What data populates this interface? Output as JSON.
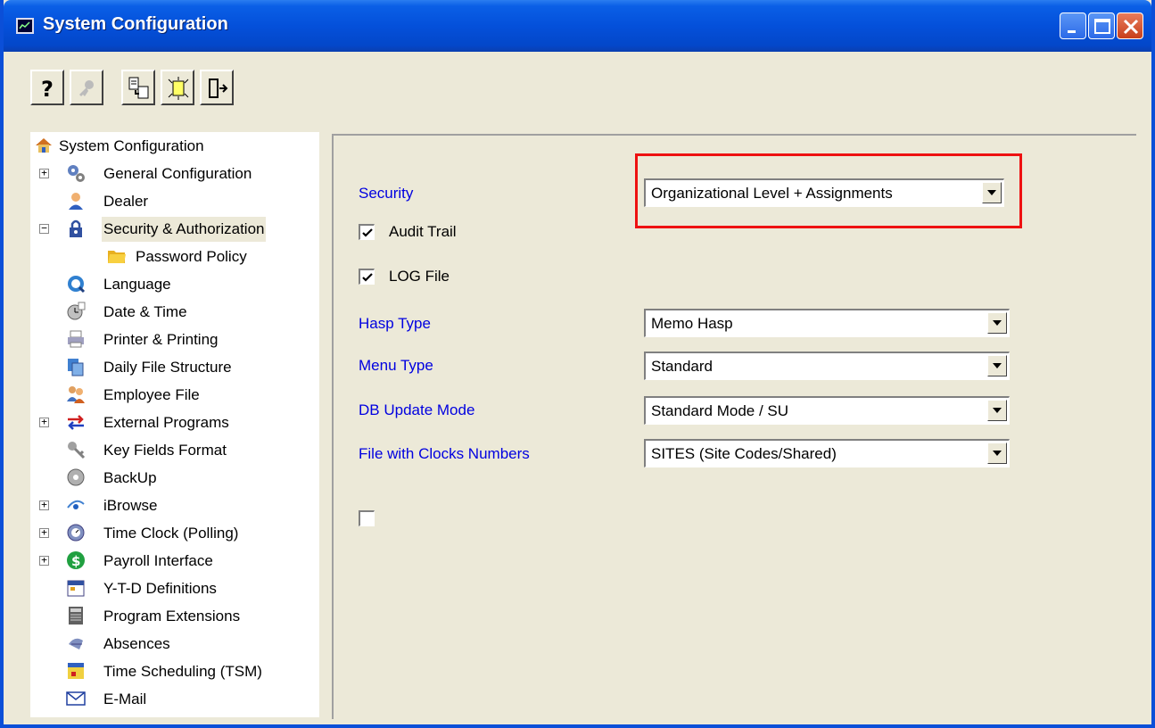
{
  "window": {
    "title": "System Configuration"
  },
  "toolbar": {
    "buttons": [
      {
        "name": "help",
        "icon": "question-mark-icon"
      },
      {
        "name": "key",
        "icon": "key-icon",
        "disabled": true
      },
      {
        "name": "copy",
        "icon": "copy-document-icon"
      },
      {
        "name": "new",
        "icon": "new-document-icon"
      },
      {
        "name": "exit",
        "icon": "exit-door-icon"
      }
    ]
  },
  "tree": {
    "items": [
      {
        "label": "System Configuration",
        "icon": "house-icon"
      },
      {
        "label": "General Configuration",
        "icon": "gears-icon",
        "expander": "+"
      },
      {
        "label": "Dealer",
        "icon": "person-icon"
      },
      {
        "label": "Security & Authorization",
        "icon": "padlock-icon",
        "expander": "−",
        "selected": true
      },
      {
        "label": "Password Policy",
        "icon": "folder-icon"
      },
      {
        "label": "Language",
        "icon": "globe-icon"
      },
      {
        "label": "Date & Time",
        "icon": "clock-icon"
      },
      {
        "label": "Printer & Printing",
        "icon": "printer-icon"
      },
      {
        "label": "Daily File Structure",
        "icon": "files-icon"
      },
      {
        "label": "Employee File",
        "icon": "people-icon"
      },
      {
        "label": "External Programs",
        "icon": "arrows-icon",
        "expander": "+"
      },
      {
        "label": "Key Fields Format",
        "icon": "key-icon"
      },
      {
        "label": "BackUp",
        "icon": "disc-icon"
      },
      {
        "label": "iBrowse",
        "icon": "eye-icon",
        "expander": "+"
      },
      {
        "label": "Time Clock (Polling)",
        "icon": "time-clock-icon",
        "expander": "+"
      },
      {
        "label": "Payroll Interface",
        "icon": "dollar-icon",
        "expander": "+"
      },
      {
        "label": "Y-T-D Definitions",
        "icon": "calendar-icon"
      },
      {
        "label": "Program Extensions",
        "icon": "calculator-icon"
      },
      {
        "label": "Absences",
        "icon": "absence-icon"
      },
      {
        "label": "Time Scheduling (TSM)",
        "icon": "schedule-icon"
      },
      {
        "label": "E-Mail",
        "icon": "envelope-icon"
      }
    ]
  },
  "form": {
    "security": {
      "label": "Security",
      "value": "Organizational Level + Assignments"
    },
    "audit_trail": {
      "label": "Audit Trail",
      "checked": true
    },
    "log_file": {
      "label": "LOG File",
      "checked": true
    },
    "hasp_type": {
      "label": "Hasp Type",
      "value": "Memo Hasp"
    },
    "menu_type": {
      "label": "Menu Type",
      "value": "Standard"
    },
    "db_update_mode": {
      "label": "DB Update Mode",
      "value": "Standard Mode / SU"
    },
    "clocks_file": {
      "label": "File with Clocks Numbers",
      "value": "SITES (Site Codes/Shared)"
    },
    "extra_checkbox": {
      "checked": false
    }
  },
  "colors": {
    "title_bar": "#0450da",
    "label_blue": "#0000e0",
    "highlight_red": "#e11111",
    "face": "#ece9d8"
  }
}
